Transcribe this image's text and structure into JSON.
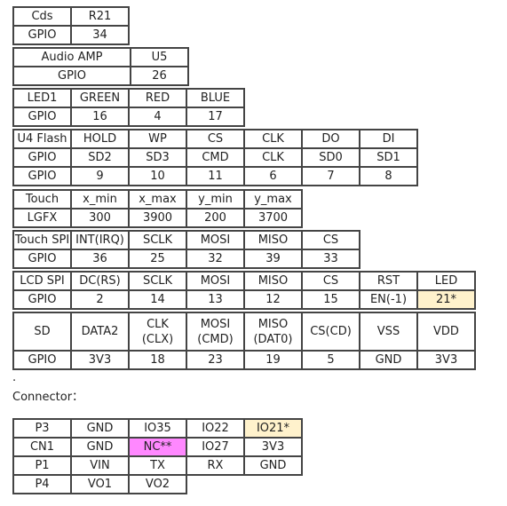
{
  "tables": [
    {
      "name": "cds",
      "rows": [
        [
          "Cds",
          "R21"
        ],
        [
          "GPIO",
          "34"
        ]
      ]
    },
    {
      "name": "audio-amp",
      "rows": [
        [
          "Audio AMP",
          "U5"
        ],
        [
          "GPIO",
          "26"
        ]
      ]
    },
    {
      "name": "led1",
      "rows": [
        [
          "LED1",
          "GREEN",
          "RED",
          "BLUE"
        ],
        [
          "GPIO",
          "16",
          "4",
          "17"
        ]
      ]
    },
    {
      "name": "u4-flash",
      "rows": [
        [
          "U4 Flash",
          "HOLD",
          "WP",
          "CS",
          "CLK",
          "DO",
          "DI"
        ],
        [
          "GPIO",
          "SD2",
          "SD3",
          "CMD",
          "CLK",
          "SD0",
          "SD1"
        ],
        [
          "GPIO",
          "9",
          "10",
          "11",
          "6",
          "7",
          "8"
        ]
      ]
    },
    {
      "name": "touch",
      "rows": [
        [
          "Touch",
          "x_min",
          "x_max",
          "y_min",
          "y_max"
        ],
        [
          "LGFX",
          "300",
          "3900",
          "200",
          "3700"
        ]
      ]
    },
    {
      "name": "touch-spi",
      "rows": [
        [
          "Touch SPI",
          "INT(IRQ)",
          "SCLK",
          "MOSI",
          "MISO",
          "CS"
        ],
        [
          "GPIO",
          "36",
          "25",
          "32",
          "39",
          "33"
        ]
      ]
    },
    {
      "name": "lcd-spi",
      "rows": [
        [
          "LCD SPI",
          "DC(RS)",
          "SCLK",
          "MOSI",
          "MISO",
          "CS",
          "RST",
          "LED"
        ],
        [
          "GPIO",
          "2",
          "14",
          "13",
          "12",
          "15",
          "EN(-1)",
          "21*"
        ]
      ]
    },
    {
      "name": "sd",
      "rows": [
        [
          "SD",
          "DATA2",
          "CLK\n(CLX)",
          "MOSI\n(CMD)",
          "MISO\n(DAT0)",
          "CS(CD)",
          "VSS",
          "VDD"
        ],
        [
          "GPIO",
          "3V3",
          "18",
          "23",
          "19",
          "5",
          "GND",
          "3V3"
        ]
      ]
    }
  ],
  "dot_text": ".",
  "connector_label": "Connector：",
  "connector": {
    "rows": [
      [
        "P3",
        "GND",
        "IO35",
        "IO22",
        "IO21*"
      ],
      [
        "CN1",
        "GND",
        "NC**",
        "IO27",
        "3V3"
      ],
      [
        "P1",
        "VIN",
        "TX",
        "RX",
        "GND"
      ],
      [
        "P4",
        "VO1",
        "VO2"
      ]
    ]
  },
  "colors": {
    "highlight_yellow": "#fff2cc",
    "highlight_pink": "#ff88ff",
    "border": "#444444"
  }
}
